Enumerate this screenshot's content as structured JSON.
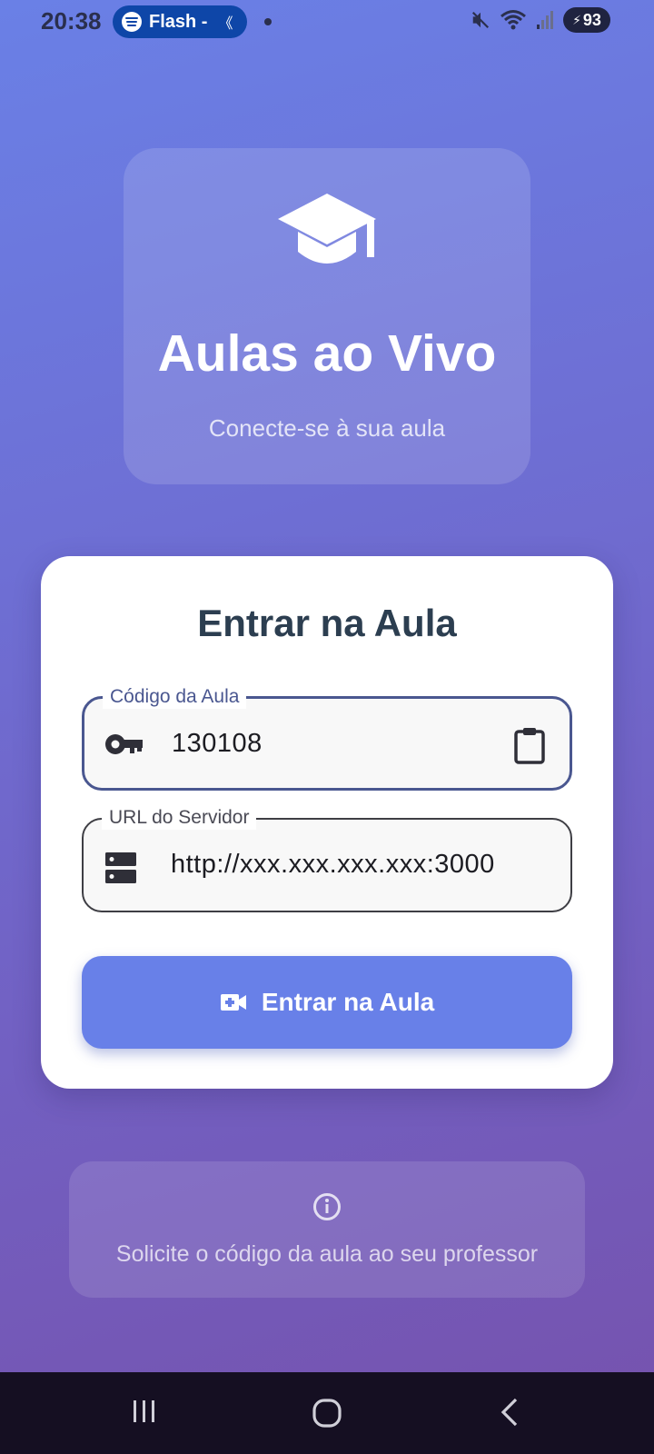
{
  "status_bar": {
    "time": "20:38",
    "media_label": "Flash -",
    "media_chevron": "《",
    "battery": "93",
    "icons": [
      "mute-icon",
      "wifi-icon",
      "signal-icon",
      "battery-charging-icon"
    ]
  },
  "hero": {
    "icon": "graduation-cap-icon",
    "title": "Aulas ao Vivo",
    "subtitle": "Conecte-se à sua aula"
  },
  "login": {
    "title": "Entrar na Aula",
    "code_field": {
      "label": "Código da Aula",
      "value": "130108",
      "icon": "key-icon",
      "suffix_icon": "clipboard-icon"
    },
    "server_field": {
      "label": "URL do Servidor",
      "value": "http://xxx.xxx.xxx.xxx:3000",
      "icon": "server-icon"
    },
    "join_button": {
      "label": "Entrar na Aula",
      "icon": "video-call-icon"
    }
  },
  "info": {
    "icon": "info-icon",
    "text": "Solicite o código da aula ao seu professor"
  },
  "nav": {
    "buttons": [
      "recents-icon",
      "home-icon",
      "back-icon"
    ]
  },
  "colors": {
    "gradient_top": "#6a80e6",
    "gradient_bottom": "#7652ad",
    "button": "#6880e8",
    "card_title": "#2c3e50",
    "focused_border": "#4a5790"
  }
}
